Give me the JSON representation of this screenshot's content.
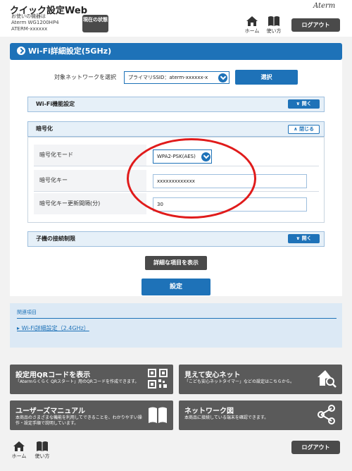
{
  "header": {
    "app_title": "クイック設定Web",
    "device_label": "お使いの機器は",
    "device_model": "Aterm WG1200HP4",
    "device_id": "ATERM-xxxxxx",
    "status_button": "現在の状態",
    "brand": "Aterm",
    "home_label": "ホーム",
    "help_label": "使い方",
    "logout_label": "ログアウト"
  },
  "page": {
    "title": "Wi-Fi詳細設定(5GHz)"
  },
  "network_select": {
    "label": "対象ネットワークを選択",
    "value": "プライマリSSID：aterm-xxxxxx-x",
    "select_button": "選択"
  },
  "sections": {
    "wifi_function": {
      "title": "Wi-Fi機能設定",
      "toggle": "開く"
    },
    "encryption": {
      "title": "暗号化",
      "toggle": "閉じる"
    },
    "child_limit": {
      "title": "子機の接続制限",
      "toggle": "開く"
    }
  },
  "encryption_fields": {
    "mode": {
      "label": "暗号化モード",
      "value": "WPA2-PSK(AES)"
    },
    "key": {
      "label": "暗号化キー",
      "value": "xxxxxxxxxxxxx"
    },
    "interval": {
      "label": "暗号化キー更新間隔(分)",
      "value": "30"
    }
  },
  "actions": {
    "show_detail": "詳細な項目を表示",
    "save": "設定"
  },
  "related": {
    "title": "関連項目",
    "link": "Wi-Fi詳細設定（2.4GHz）"
  },
  "tiles": [
    {
      "title": "設定用QRコードを表示",
      "desc": "「Atermらくらく QRスタート」用のQRコードを作成できます。",
      "icon": "qr-code-icon"
    },
    {
      "title": "見えて安心ネット",
      "desc": "「こども安心ネットタイマー」などの設定はこちらから。",
      "icon": "house-search-icon"
    },
    {
      "title": "ユーザーズマニュアル",
      "desc": "本商品のさまざまな機能を利用してできることを、わかりやすい操作・設定手順で説明しています。",
      "icon": "book-icon"
    },
    {
      "title": "ネットワーク図",
      "desc": "本商品に接続している端末を確認できます。",
      "icon": "network-icon"
    }
  ],
  "footer": {
    "home_label": "ホーム",
    "help_label": "使い方",
    "logout_label": "ログアウト"
  },
  "colors": {
    "primary_blue": "#1e72b8",
    "dark_gray": "#4a4a4a",
    "highlight_red": "#e01b1b"
  }
}
